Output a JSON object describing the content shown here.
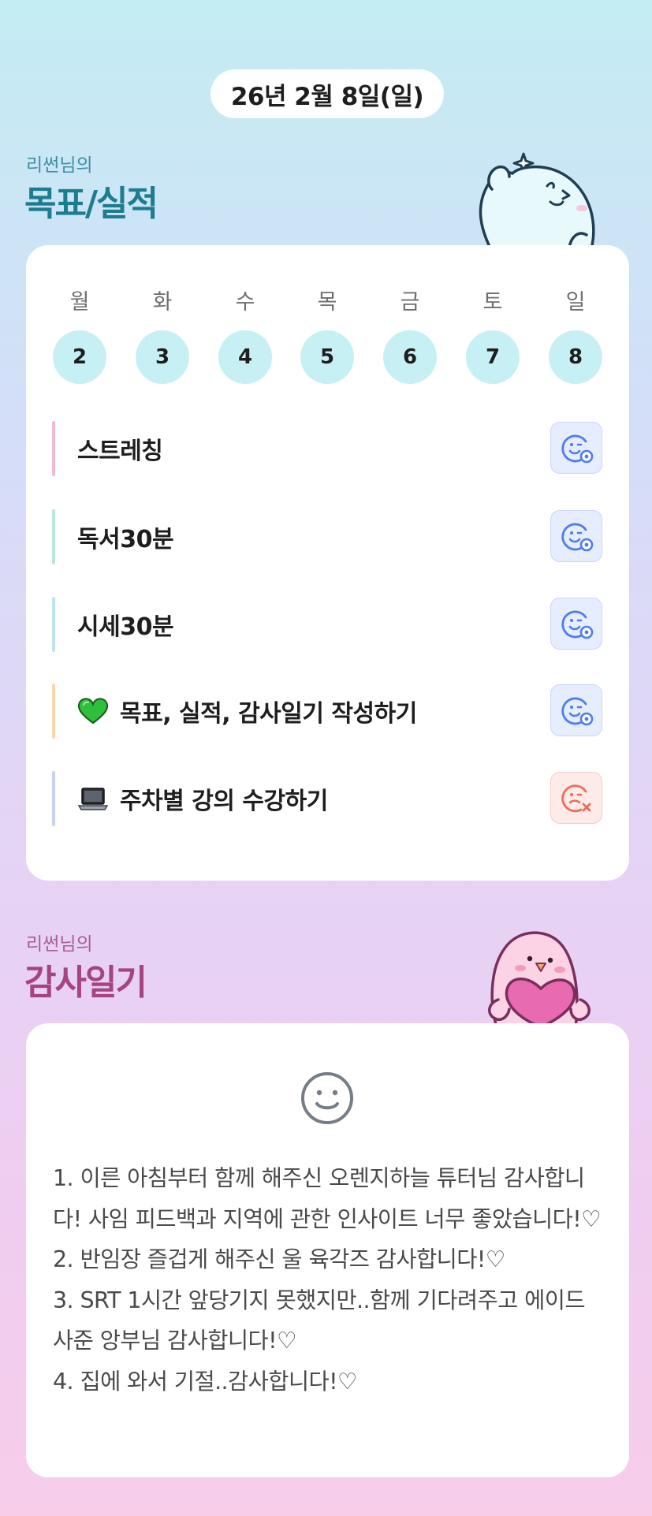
{
  "header": {
    "date": "26년 2월 8일(일)"
  },
  "goals_section": {
    "subtitle": "리썬님의",
    "title": "목표/실적",
    "accent_color": "#1d7d8f",
    "mascot": "sparkle-ghost-mascot"
  },
  "week": {
    "days": [
      {
        "label": "월",
        "date": "2"
      },
      {
        "label": "화",
        "date": "3"
      },
      {
        "label": "수",
        "date": "4"
      },
      {
        "label": "목",
        "date": "5"
      },
      {
        "label": "금",
        "date": "6"
      },
      {
        "label": "토",
        "date": "7"
      },
      {
        "label": "일",
        "date": "8"
      }
    ]
  },
  "goals": [
    {
      "text": "스트레칭",
      "emoji": "",
      "status": "done",
      "bar_color": "#f5b8cf",
      "status_icon": "smile-check-icon"
    },
    {
      "text": "독서30분",
      "emoji": "",
      "status": "done",
      "bar_color": "#bde5dc",
      "status_icon": "smile-check-icon"
    },
    {
      "text": "시세30분",
      "emoji": "",
      "status": "done",
      "bar_color": "#bfe4f0",
      "status_icon": "smile-check-icon"
    },
    {
      "text": "목표, 실적, 감사일기 작성하기",
      "emoji": "green-heart",
      "status": "done",
      "bar_color": "#f7d6b0",
      "status_icon": "smile-check-icon"
    },
    {
      "text": "주차별 강의 수강하기",
      "emoji": "laptop",
      "status": "not-done",
      "bar_color": "#c9d2f1",
      "status_icon": "smile-x-icon"
    }
  ],
  "gratitude_section": {
    "subtitle": "리썬님의",
    "title": "감사일기",
    "accent_color": "#a4457f",
    "mascot": "pink-bird-heart-mascot",
    "mood_icon": "smile-face-icon",
    "entry": "1. 이른 아침부터 함께 해주신 오렌지하늘 튜터님 감사합니다! 사임 피드백과 지역에 관한 인사이트 너무 좋았습니다!♡\n2. 반임장 즐겁게 해주신 울 육각즈 감사합니다!♡\n3. SRT 1시간 앞당기지 못했지만..함께 기다려주고 에이드 사준 앙부님 감사합니다!♡\n4. 집에 와서 기절..감사합니다!♡"
  },
  "colors": {
    "day_circle": "#c7f0f5",
    "status_done": "#4c7cf0",
    "status_fail": "#ef6b5a"
  }
}
